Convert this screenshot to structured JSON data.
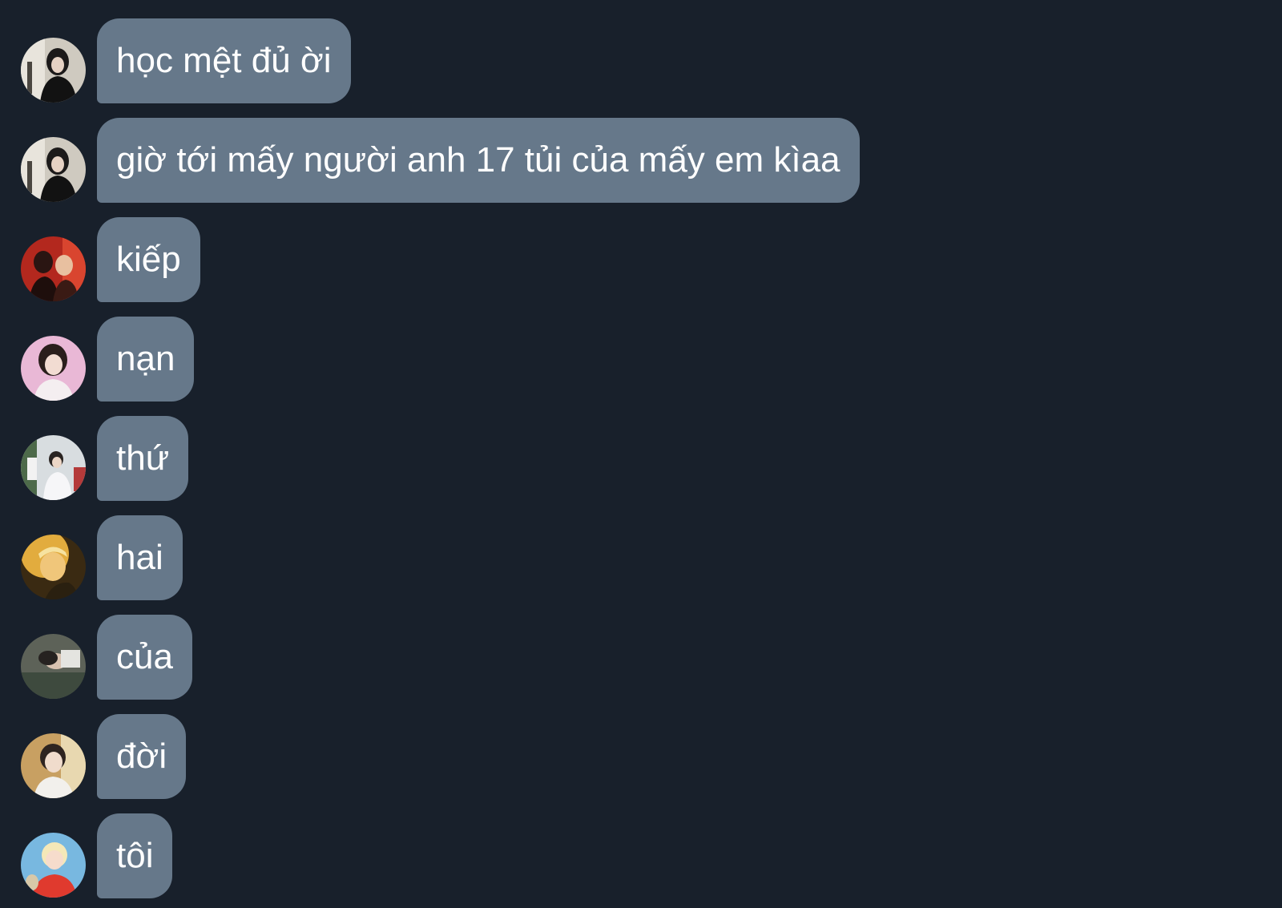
{
  "colors": {
    "background": "#18202b",
    "bubble": "#66788a",
    "text": "#ffffff"
  },
  "messages": [
    {
      "text": "học mệt đủ ời",
      "avatar_icon": "avatar-photo-icon"
    },
    {
      "text": "giờ tới mấy người anh 17 tủi của mấy em kìaa",
      "avatar_icon": "avatar-photo-icon"
    },
    {
      "text": "kiếp",
      "avatar_icon": "avatar-photo-icon"
    },
    {
      "text": "nạn",
      "avatar_icon": "avatar-photo-icon"
    },
    {
      "text": "thứ",
      "avatar_icon": "avatar-photo-icon"
    },
    {
      "text": "hai",
      "avatar_icon": "avatar-photo-icon"
    },
    {
      "text": "của",
      "avatar_icon": "avatar-photo-icon"
    },
    {
      "text": "đời",
      "avatar_icon": "avatar-photo-icon"
    },
    {
      "text": "tôi",
      "avatar_icon": "avatar-photo-icon"
    }
  ]
}
